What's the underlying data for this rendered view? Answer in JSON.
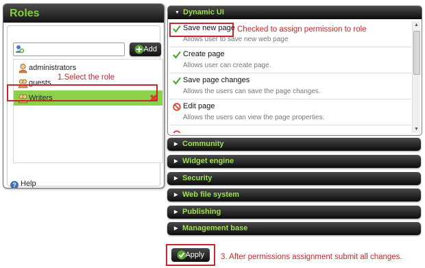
{
  "roles": {
    "title": "Roles",
    "search": {
      "value": "",
      "placeholder": ""
    },
    "add_label": "Add",
    "items": [
      {
        "label": "administrators",
        "selected": false
      },
      {
        "label": "guests",
        "selected": false
      },
      {
        "label": "Writers",
        "selected": true
      }
    ],
    "help_label": "Help"
  },
  "permissions": {
    "open_section": "Dynamic UI",
    "items": [
      {
        "title": "Save new page",
        "description": "Allows user to save new web page",
        "state": "allowed"
      },
      {
        "title": "Create page",
        "description": "Allows user can create page.",
        "state": "allowed"
      },
      {
        "title": "Save page changes",
        "description": "Allows the users can save the page changes.",
        "state": "allowed"
      },
      {
        "title": "Edit page",
        "description": "Allows the users can view the page properties.",
        "state": "denied"
      }
    ],
    "sections": [
      "Community",
      "Widget engine",
      "Security",
      "Web file system",
      "Publishing",
      "Management base"
    ]
  },
  "apply_label": "Apply",
  "annotations": {
    "select_role": "1.Select the role",
    "checked": "Checked to assign permission to role",
    "after": "3. After permissions assignment submit all changes."
  },
  "colors": {
    "accent_green": "#7dd13a",
    "selected_row": "#8cd14a",
    "annotation_red": "#c8262b",
    "deny_red": "#d8402c"
  },
  "icons": [
    "user-search-icon",
    "plus-icon",
    "admin-user-icon",
    "group-icon",
    "delete-icon",
    "help-icon",
    "check-icon",
    "deny-icon",
    "expand-arrow-icon",
    "collapse-arrow-icon"
  ]
}
